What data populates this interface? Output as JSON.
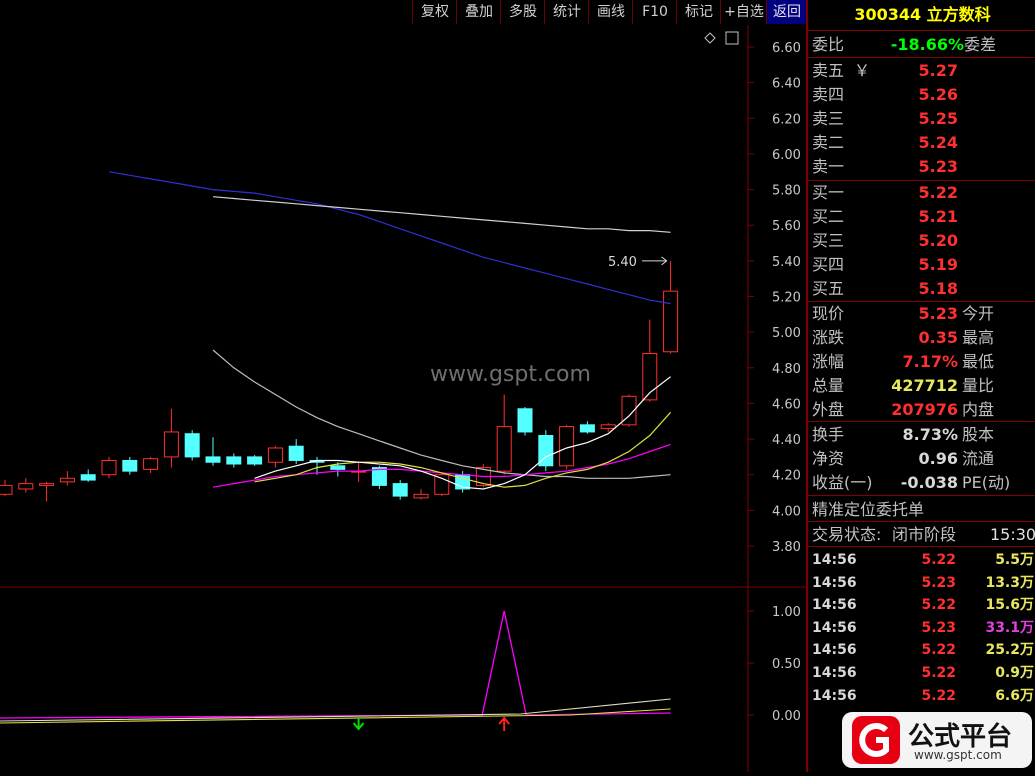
{
  "toolbar": {
    "buttons": [
      "复权",
      "叠加",
      "多股",
      "统计",
      "画线",
      "F10",
      "标记",
      "+自选",
      "返回"
    ]
  },
  "watermark": "www.gspt.com",
  "chart": {
    "price_axis": [
      "6.60",
      "6.40",
      "6.20",
      "6.00",
      "5.80",
      "5.60",
      "5.40",
      "5.20",
      "5.00",
      "4.80",
      "4.60",
      "4.40",
      "4.20",
      "4.00",
      "3.80"
    ],
    "indicator_axis": [
      "1.00",
      "0.50",
      "0.00"
    ],
    "high_annotation": "5.40"
  },
  "chart_data": {
    "type": "candlestick",
    "candles": [
      {
        "o": 4.09,
        "c": 4.14,
        "h": 4.17,
        "l": 4.08
      },
      {
        "o": 4.12,
        "c": 4.15,
        "h": 4.18,
        "l": 4.1
      },
      {
        "o": 4.14,
        "c": 4.15,
        "h": 4.16,
        "l": 4.05
      },
      {
        "o": 4.16,
        "c": 4.18,
        "h": 4.22,
        "l": 4.14
      },
      {
        "o": 4.2,
        "c": 4.17,
        "h": 4.23,
        "l": 4.16
      },
      {
        "o": 4.2,
        "c": 4.28,
        "h": 4.3,
        "l": 4.18
      },
      {
        "o": 4.28,
        "c": 4.22,
        "h": 4.3,
        "l": 4.2
      },
      {
        "o": 4.23,
        "c": 4.29,
        "h": 4.3,
        "l": 4.21
      },
      {
        "o": 4.3,
        "c": 4.44,
        "h": 4.57,
        "l": 4.24
      },
      {
        "o": 4.43,
        "c": 4.3,
        "h": 4.45,
        "l": 4.28
      },
      {
        "o": 4.3,
        "c": 4.27,
        "h": 4.41,
        "l": 4.25
      },
      {
        "o": 4.3,
        "c": 4.26,
        "h": 4.32,
        "l": 4.24
      },
      {
        "o": 4.3,
        "c": 4.26,
        "h": 4.31,
        "l": 4.25
      },
      {
        "o": 4.27,
        "c": 4.35,
        "h": 4.36,
        "l": 4.24
      },
      {
        "o": 4.36,
        "c": 4.28,
        "h": 4.4,
        "l": 4.26
      },
      {
        "o": 4.28,
        "c": 4.27,
        "h": 4.3,
        "l": 4.2
      },
      {
        "o": 4.25,
        "c": 4.23,
        "h": 4.27,
        "l": 4.19
      },
      {
        "o": 4.22,
        "c": 4.22,
        "h": 4.27,
        "l": 4.16
      },
      {
        "o": 4.24,
        "c": 4.14,
        "h": 4.25,
        "l": 4.12
      },
      {
        "o": 4.15,
        "c": 4.08,
        "h": 4.17,
        "l": 4.06
      },
      {
        "o": 4.07,
        "c": 4.09,
        "h": 4.12,
        "l": 4.06
      },
      {
        "o": 4.09,
        "c": 4.2,
        "h": 4.21,
        "l": 4.08
      },
      {
        "o": 4.2,
        "c": 4.12,
        "h": 4.22,
        "l": 4.1
      },
      {
        "o": 4.14,
        "c": 4.24,
        "h": 4.26,
        "l": 4.13
      },
      {
        "o": 4.22,
        "c": 4.47,
        "h": 4.65,
        "l": 4.2
      },
      {
        "o": 4.57,
        "c": 4.44,
        "h": 4.58,
        "l": 4.42
      },
      {
        "o": 4.42,
        "c": 4.25,
        "h": 4.45,
        "l": 4.22
      },
      {
        "o": 4.25,
        "c": 4.47,
        "h": 4.48,
        "l": 4.23
      },
      {
        "o": 4.48,
        "c": 4.44,
        "h": 4.5,
        "l": 4.43
      },
      {
        "o": 4.46,
        "c": 4.48,
        "h": 4.49,
        "l": 4.44
      },
      {
        "o": 4.48,
        "c": 4.64,
        "h": 4.65,
        "l": 4.47
      },
      {
        "o": 4.62,
        "c": 4.88,
        "h": 5.07,
        "l": 4.61
      },
      {
        "o": 4.89,
        "c": 5.23,
        "h": 5.4,
        "l": 4.88
      }
    ],
    "moving_averages": [
      {
        "name": "MA-blue",
        "color": "#3030d0",
        "points": [
          5.9,
          5.88,
          5.86,
          5.84,
          5.82,
          5.8,
          5.79,
          5.78,
          5.76,
          5.74,
          5.72,
          5.69,
          5.66,
          5.62,
          5.58,
          5.54,
          5.5,
          5.46,
          5.42,
          5.39,
          5.36,
          5.33,
          5.3,
          5.27,
          5.24,
          5.21,
          5.18,
          5.16
        ]
      },
      {
        "name": "MA-white-long",
        "color": "#d0d0d0",
        "points": [
          5.76,
          5.75,
          5.74,
          5.73,
          5.72,
          5.71,
          5.7,
          5.69,
          5.68,
          5.67,
          5.66,
          5.65,
          5.64,
          5.63,
          5.62,
          5.61,
          5.6,
          5.59,
          5.58,
          5.58,
          5.57,
          5.57,
          5.56
        ]
      },
      {
        "name": "MA-grey",
        "color": "#bdbdbd",
        "points": [
          4.9,
          4.8,
          4.72,
          4.65,
          4.58,
          4.52,
          4.47,
          4.43,
          4.39,
          4.35,
          4.31,
          4.28,
          4.25,
          4.23,
          4.21,
          4.2,
          4.19,
          4.19,
          4.18,
          4.18,
          4.18,
          4.19,
          4.2
        ]
      },
      {
        "name": "MA-magenta",
        "color": "#ff00ff",
        "points": [
          4.13,
          4.15,
          4.17,
          4.19,
          4.2,
          4.21,
          4.22,
          4.22,
          4.23,
          4.23,
          4.22,
          4.21,
          4.2,
          4.19,
          4.19,
          4.2,
          4.21,
          4.22,
          4.24,
          4.26,
          4.29,
          4.33,
          4.37
        ]
      },
      {
        "name": "MA-yellow",
        "color": "#e0e040",
        "points": [
          4.16,
          4.18,
          4.2,
          4.24,
          4.26,
          4.27,
          4.27,
          4.26,
          4.24,
          4.21,
          4.18,
          4.15,
          4.13,
          4.14,
          4.18,
          4.21,
          4.23,
          4.27,
          4.33,
          4.42,
          4.55
        ]
      },
      {
        "name": "MA-white-short",
        "color": "#ffffff",
        "points": [
          4.18,
          4.22,
          4.25,
          4.28,
          4.28,
          4.27,
          4.26,
          4.25,
          4.22,
          4.18,
          4.13,
          4.12,
          4.15,
          4.2,
          4.3,
          4.35,
          4.38,
          4.43,
          4.53,
          4.66,
          4.75
        ]
      }
    ],
    "indicator": {
      "spike_value": 1.0
    }
  },
  "side": {
    "title": "300344 立方数科",
    "weibi": {
      "label": "委比",
      "value": "-18.66%",
      "label2": "委差"
    },
    "asks": [
      {
        "label": "卖五",
        "extra": "￥",
        "value": "5.27"
      },
      {
        "label": "卖四",
        "extra": "",
        "value": "5.26"
      },
      {
        "label": "卖三",
        "extra": "",
        "value": "5.25"
      },
      {
        "label": "卖二",
        "extra": "",
        "value": "5.24"
      },
      {
        "label": "卖一",
        "extra": "",
        "value": "5.23"
      }
    ],
    "bids": [
      {
        "label": "买一",
        "value": "5.22"
      },
      {
        "label": "买二",
        "value": "5.21"
      },
      {
        "label": "买三",
        "value": "5.20"
      },
      {
        "label": "买四",
        "value": "5.19"
      },
      {
        "label": "买五",
        "value": "5.18"
      }
    ],
    "quote1": [
      {
        "label": "现价",
        "value": "5.23",
        "label2": "今开",
        "color": "#ff3030"
      },
      {
        "label": "涨跌",
        "value": "0.35",
        "label2": "最高",
        "color": "#ff3030"
      },
      {
        "label": "涨幅",
        "value": "7.17%",
        "label2": "最低",
        "color": "#ff3030"
      },
      {
        "label": "总量",
        "value": "427712",
        "label2": "量比",
        "color": "#e8e860"
      },
      {
        "label": "外盘",
        "value": "207976",
        "label2": "内盘",
        "color": "#ff3030"
      }
    ],
    "quote2": [
      {
        "label": "换手",
        "value": "8.73%",
        "label2": "股本"
      },
      {
        "label": "净资",
        "value": "0.96",
        "label2": "流通"
      },
      {
        "label": "收益(一)",
        "value": "-0.038",
        "label2": "PE(动)"
      }
    ],
    "order_title": "精准定位委托单",
    "status": {
      "label": "交易状态:",
      "value": "闭市阶段",
      "time": "15:30:"
    },
    "ticks": [
      {
        "time": "14:56",
        "price": "5.22",
        "vol": "5.5万",
        "vcolor": "#e8e860"
      },
      {
        "time": "14:56",
        "price": "5.23",
        "vol": "13.3万",
        "vcolor": "#e8e860"
      },
      {
        "time": "14:56",
        "price": "5.22",
        "vol": "15.6万",
        "vcolor": "#e8e860"
      },
      {
        "time": "14:56",
        "price": "5.23",
        "vol": "33.1万",
        "vcolor": "#e040e0"
      },
      {
        "time": "14:56",
        "price": "5.22",
        "vol": "25.2万",
        "vcolor": "#e8e860"
      },
      {
        "time": "14:56",
        "price": "5.22",
        "vol": "0.9万",
        "vcolor": "#e8e860"
      },
      {
        "time": "14:56",
        "price": "5.22",
        "vol": "6.6万",
        "vcolor": "#e8e860"
      }
    ],
    "logo": {
      "text": "公式平台",
      "url": "www.gspt.com"
    }
  },
  "colors": {
    "up": "#ff3030",
    "down": "#54ffff",
    "grid": "#800000",
    "text": "#c0c0c0",
    "accent": "#ffff00"
  }
}
